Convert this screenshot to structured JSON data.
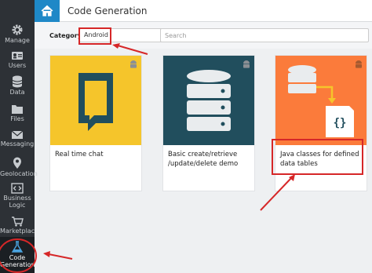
{
  "sidebar": {
    "items": [
      {
        "label": "Manage",
        "icon": "gear-icon"
      },
      {
        "label": "Users",
        "icon": "users-icon"
      },
      {
        "label": "Data",
        "icon": "database-icon"
      },
      {
        "label": "Files",
        "icon": "folder-icon"
      },
      {
        "label": "Messaging",
        "icon": "envelope-icon"
      },
      {
        "label": "Geolocation",
        "icon": "map-pin-icon"
      },
      {
        "label": "Business Logic",
        "icon": "code-icon"
      },
      {
        "label": "Marketplace",
        "icon": "cart-icon"
      },
      {
        "label": "Code Generation",
        "icon": "flask-icon",
        "active": true
      }
    ]
  },
  "header": {
    "title": "Code Generation",
    "home_icon": "home-icon"
  },
  "filter": {
    "category_label": "Category:",
    "category_value": "Android",
    "search_placeholder": "Search"
  },
  "templates": [
    {
      "caption": "Real time chat",
      "color": "#f5c52b",
      "icon": "chat-icon"
    },
    {
      "caption": "Basic create/retrieve /update/delete demo",
      "color": "#214e5d",
      "icon": "database-icon"
    },
    {
      "caption": "Java classes for defined data tables",
      "color": "#fb7b3b",
      "icon": "code-file-icon"
    }
  ],
  "colors": {
    "accent": "#1e88c7",
    "sidebar": "#2d3136",
    "annotation": "#d62728"
  }
}
